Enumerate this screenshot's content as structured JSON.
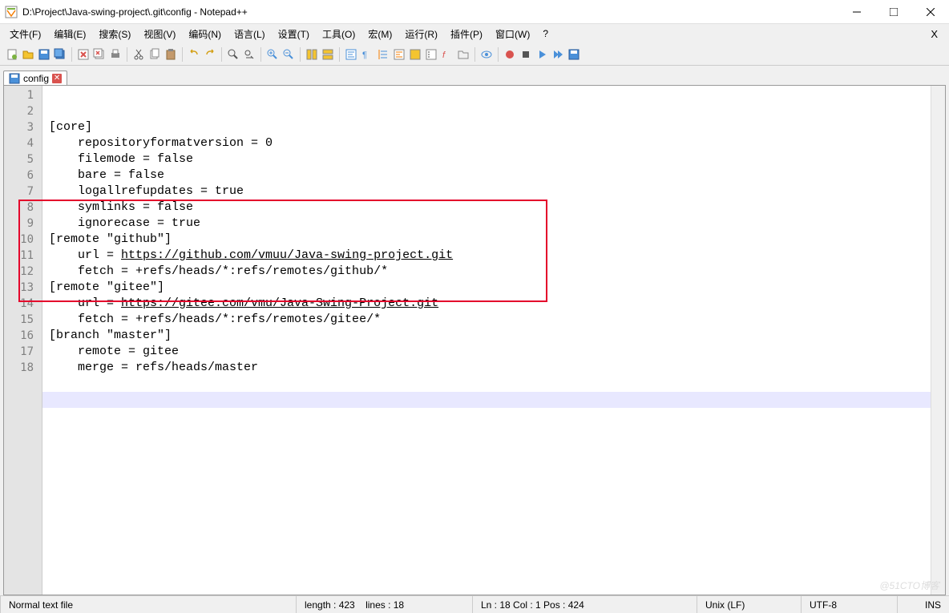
{
  "title": "D:\\Project\\Java-swing-project\\.git\\config - Notepad++",
  "menus": [
    "文件(F)",
    "编辑(E)",
    "搜索(S)",
    "视图(V)",
    "编码(N)",
    "语言(L)",
    "设置(T)",
    "工具(O)",
    "宏(M)",
    "运行(R)",
    "插件(P)",
    "窗口(W)",
    "?"
  ],
  "tab": {
    "name": "config"
  },
  "code_lines": [
    "[core]",
    "    repositoryformatversion = 0",
    "    filemode = false",
    "    bare = false",
    "    logallrefupdates = true",
    "    symlinks = false",
    "    ignorecase = true",
    "[remote \"github\"]",
    "    url = ",
    "    fetch = +refs/heads/*:refs/remotes/github/*",
    "[remote \"gitee\"]",
    "    url = ",
    "    fetch = +refs/heads/*:refs/remotes/gitee/*",
    "[branch \"master\"]",
    "    remote = gitee",
    "    merge = refs/heads/master",
    "",
    ""
  ],
  "urls": {
    "github": "https://github.com/vmuu/Java-swing-project.git",
    "gitee": "https://gitee.com/vmu/Java-Swing-Project.git"
  },
  "status": {
    "filetype": "Normal text file",
    "length_label": "length : 423",
    "lines_label": "lines : 18",
    "pos_label": "Ln : 18    Col : 1    Pos : 424",
    "eol": "Unix (LF)",
    "encoding": "UTF-8",
    "mode": "INS"
  },
  "watermark": "@51CTO博客"
}
